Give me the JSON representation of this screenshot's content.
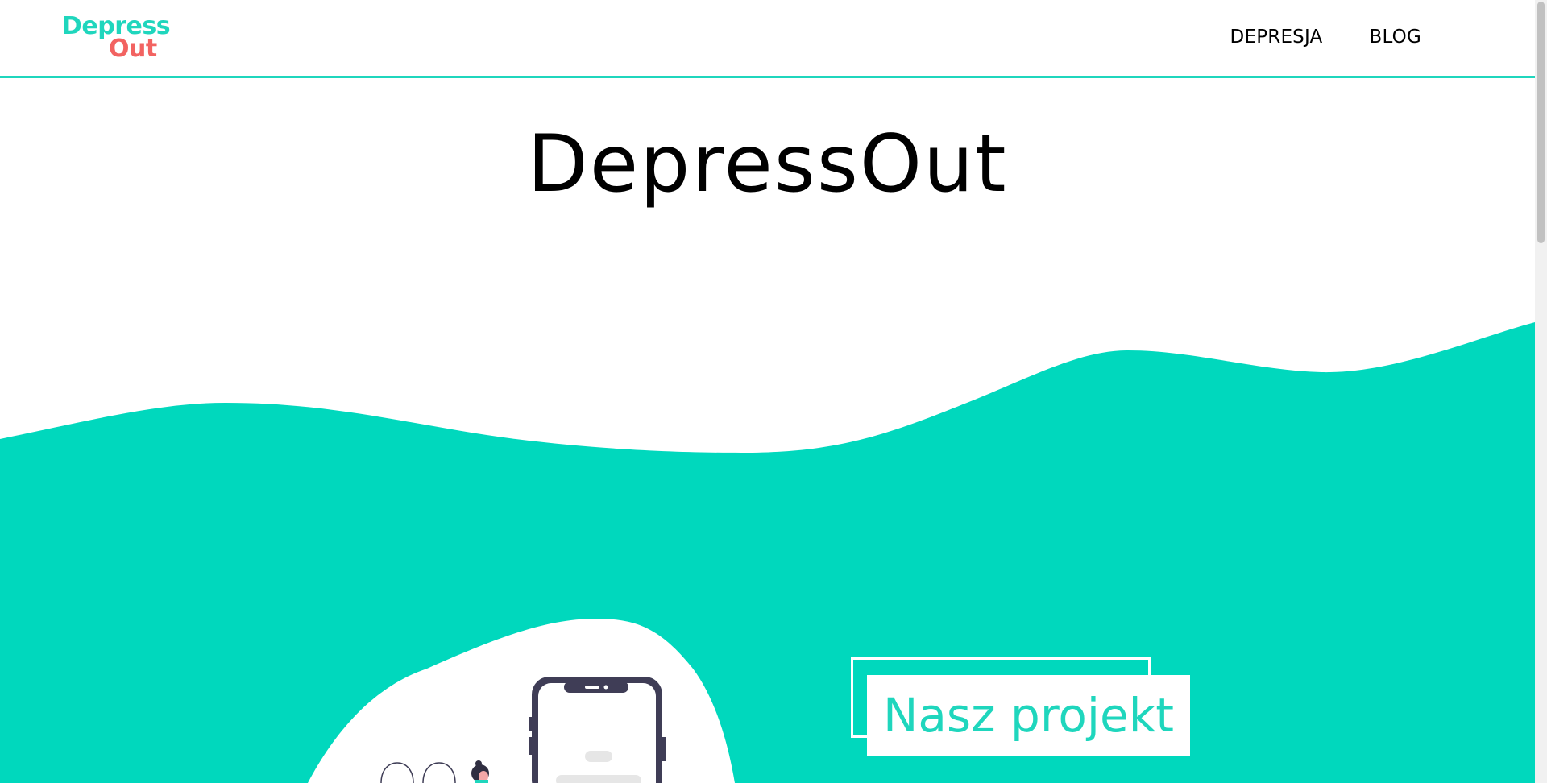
{
  "header": {
    "logo_top": "Depress",
    "logo_bottom": "Out",
    "nav": [
      {
        "label": "DEPRESJA"
      },
      {
        "label": "BLOG"
      }
    ]
  },
  "hero": {
    "title": "DepressOut"
  },
  "project": {
    "label": "Nasz projekt"
  },
  "colors": {
    "accent": "#1fd6bd",
    "logo_accent": "#f26361",
    "text": "#000000",
    "background": "#ffffff",
    "phone_frame": "#3f3d56"
  },
  "icons": {
    "phone": "phone-illustration",
    "person": "person-illustration"
  }
}
